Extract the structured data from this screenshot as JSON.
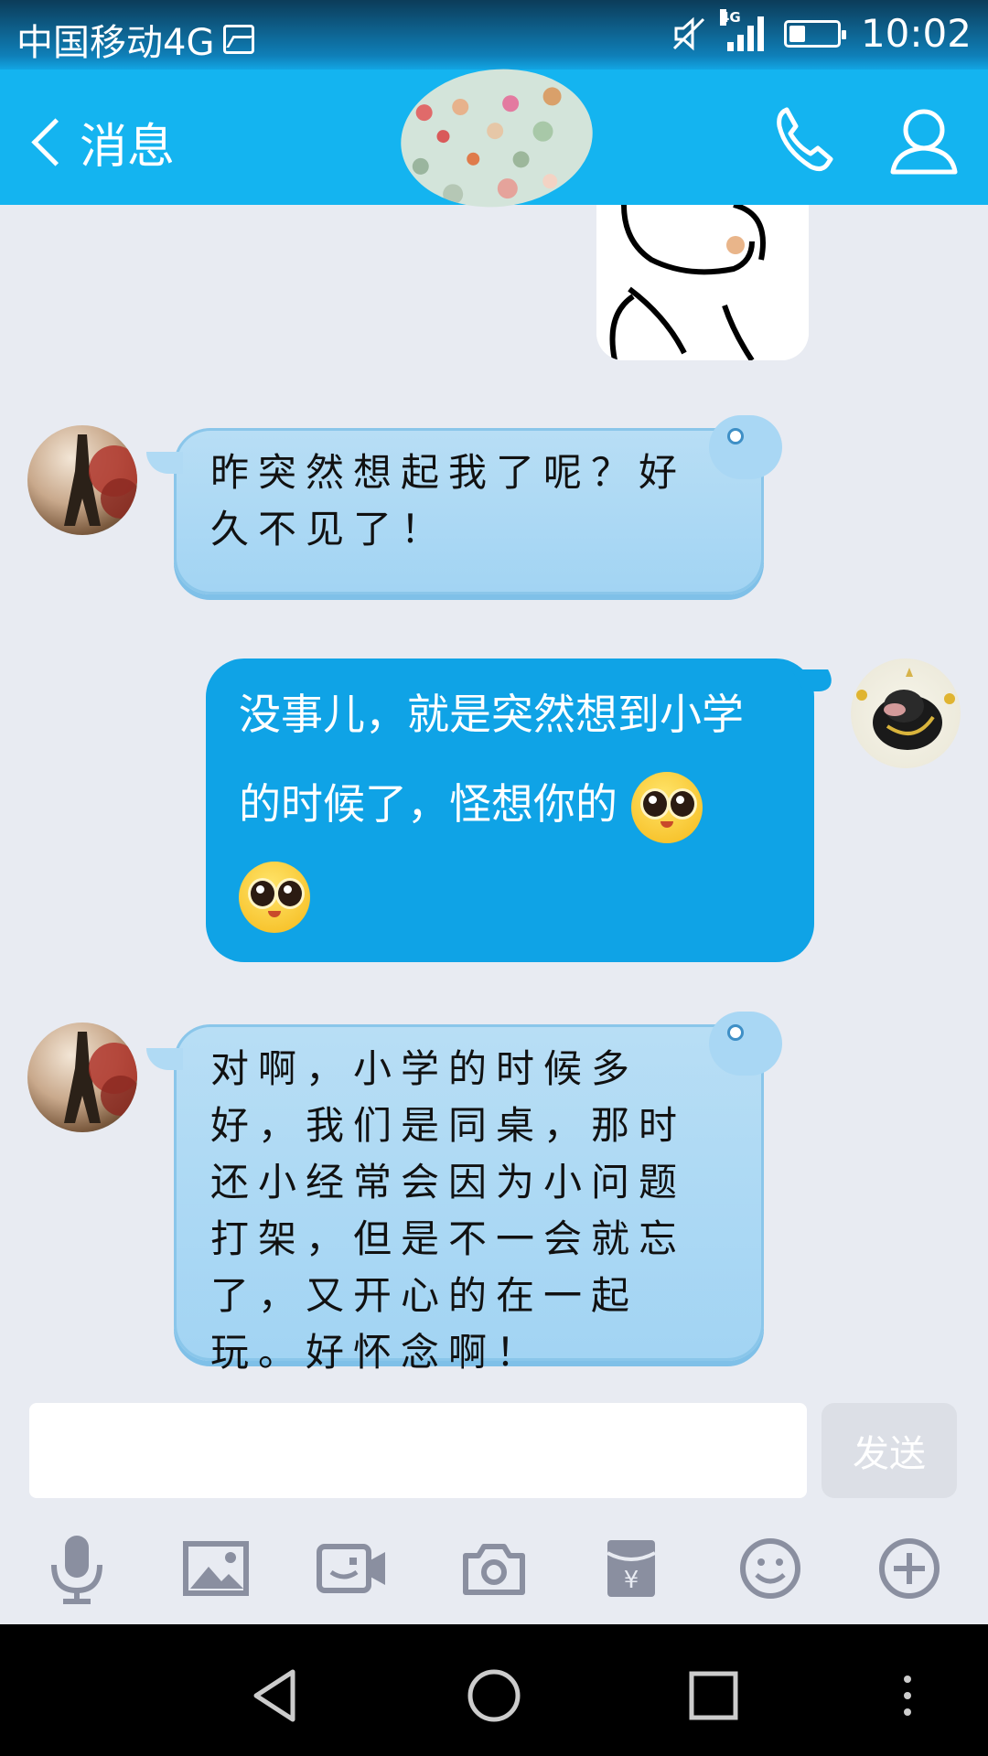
{
  "status_bar": {
    "carrier": "中国移动4G",
    "network_tag": "4G",
    "time": "10:02",
    "battery_level": 0.35
  },
  "header": {
    "back_label": "消息",
    "icons": {
      "back": "chevron-left-icon",
      "call": "phone-icon",
      "profile": "person-icon"
    }
  },
  "messages": [
    {
      "direction": "incoming",
      "type": "text",
      "text": "昨突然想起我了呢？好久不见了！"
    },
    {
      "direction": "outgoing",
      "type": "text",
      "text": "没事儿，就是突然想到小学的时候了，怪想你的",
      "emoji": [
        "blushing-emoji",
        "blushing-emoji"
      ]
    },
    {
      "direction": "incoming",
      "type": "text",
      "text": "对啊，小学的时候多好，我们是同桌，那时还小经常会因为小问题打架，但是不一会就忘了，又开心的在一起玩。好怀念啊！"
    }
  ],
  "composer": {
    "value": "",
    "send_label": "发送"
  },
  "toolbar": {
    "icons": [
      "microphone-icon",
      "image-icon",
      "video-call-icon",
      "camera-icon",
      "red-packet-icon",
      "emoji-icon",
      "plus-icon"
    ]
  },
  "nav": {
    "icons": [
      "back-triangle-icon",
      "home-circle-icon",
      "recents-square-icon",
      "menu-dots-icon"
    ]
  },
  "colors": {
    "header": "#14b4f0",
    "outgoing_bubble": "#0fa3e6",
    "incoming_bubble": "#a9d7f4",
    "background": "#e8ebf2",
    "icon_gray": "#8a8fa0"
  }
}
